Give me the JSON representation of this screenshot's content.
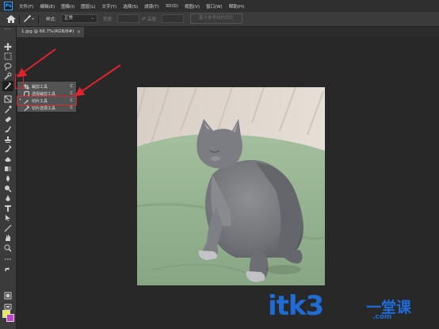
{
  "app": {
    "logo_text": "Ps"
  },
  "menubar": {
    "items": [
      "文件(F)",
      "编辑(E)",
      "图像(I)",
      "图层(L)",
      "文字(Y)",
      "选择(S)",
      "滤镜(T)",
      "3D(D)",
      "视图(V)",
      "窗口(W)",
      "帮助(H)"
    ]
  },
  "options_bar": {
    "style_label": "样式:",
    "style_value": "正常",
    "width_label": "宽度:",
    "height_label": "高度:",
    "guides_button": "基于参考线的切片"
  },
  "document": {
    "tab_title": "1.jpg @ 66.7%(RGB/8#)",
    "tab_close": "×"
  },
  "flyout": {
    "items": [
      {
        "label": "裁剪工具",
        "shortcut": "C",
        "icon": "crop-icon",
        "checked": false
      },
      {
        "label": "透视裁剪工具",
        "shortcut": "C",
        "icon": "perspective-crop-icon",
        "checked": false
      },
      {
        "label": "切片工具",
        "shortcut": "C",
        "icon": "slice-icon",
        "checked": true
      },
      {
        "label": "切片选择工具",
        "shortcut": "C",
        "icon": "slice-select-icon",
        "checked": false
      }
    ],
    "check_mark": "•"
  },
  "tools": [
    "move-icon",
    "marquee-icon",
    "lasso-icon",
    "quick-select-icon",
    "slice-icon",
    "frame-icon",
    "eyedropper-icon",
    "healing-icon",
    "brush-icon",
    "stamp-icon",
    "history-brush-icon",
    "eraser-icon",
    "gradient-icon",
    "blur-icon",
    "dodge-icon",
    "pen-icon",
    "type-icon",
    "path-select-icon",
    "line-icon",
    "hand-icon",
    "zoom-icon",
    "more-icon",
    "swap-colors-icon",
    "quick-mask-icon",
    "screen-mode-icon"
  ],
  "colors": {
    "foreground": "#e8e84a",
    "background": "#c042c8",
    "highlight": "#e0242e",
    "watermark": "#1f6cd8"
  },
  "watermark": {
    "brand": "itk3",
    "cn": "一堂课",
    "url": ".com"
  }
}
